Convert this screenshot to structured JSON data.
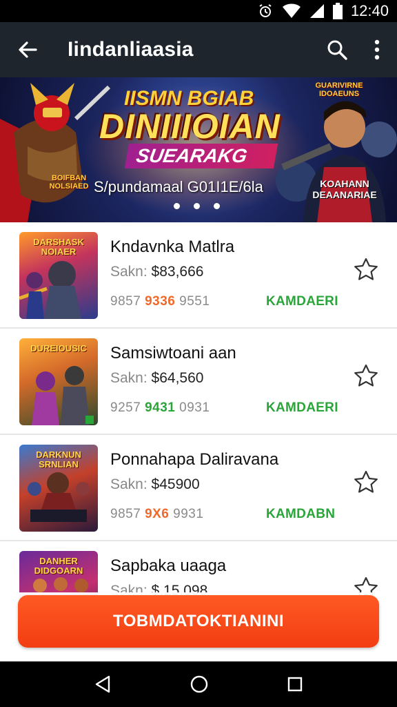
{
  "status_bar": {
    "time": "12:40"
  },
  "app_bar": {
    "title": "Iindanliaasia"
  },
  "banner": {
    "headline_top": "IISMN BGIAB",
    "headline_main": "DINIIIOIAN",
    "headline_sub": "SUEARAKG",
    "caption": "S/pundamaal G01I1E/6la",
    "badge_left": "BOIFBAN NOLSIAED",
    "badge_right": "GUARIVIRNE IDOAEUNS",
    "player_badge": "KOAHANN DEAANARIAE",
    "page_dots": 3,
    "active_dot": 1
  },
  "items": [
    {
      "name": "Kndavnka Matlra",
      "price_label": "Sakn:",
      "price": "$83,666",
      "stat_a": "9857",
      "stat_b": "9336",
      "stat_c": "9551",
      "stat_b_color": "#ef6a2a",
      "tag": "KAMDAERI",
      "thumb_label": "DARSHASK NOIAER"
    },
    {
      "name": "Samsiwtoani aan",
      "price_label": "Sakn:",
      "price": "$64,560",
      "stat_a": "9257",
      "stat_b": "9431",
      "stat_c": "0931",
      "stat_b_color": "#2aa53a",
      "tag": "KAMDAERI",
      "thumb_label": "DUREIOUSIC"
    },
    {
      "name": "Ponnahapa Daliravana",
      "price_label": "Sakn:",
      "price": "$45900",
      "stat_a": "9857",
      "stat_b": "9X6",
      "stat_c": "9931",
      "stat_b_color": "#ef6a2a",
      "tag": "KAMDABN",
      "thumb_label": "DARKNUN SRNLIAN"
    },
    {
      "name": "Sapbaka uaaga",
      "price_label": "Sakn:",
      "price": "$.15,098",
      "stat_a": "",
      "stat_b": "",
      "stat_c": "",
      "stat_b_color": "#ef6a2a",
      "tag": "",
      "thumb_label": "DANHER DIDGOARN"
    }
  ],
  "cta": {
    "label": "TOBMDATOKTIANINI"
  },
  "icons": {
    "back": "arrow-left-icon",
    "search": "search-icon",
    "more": "more-vert-icon",
    "favorite": "star-outline-icon",
    "nav_back": "triangle-back-icon",
    "nav_home": "circle-home-icon",
    "nav_recent": "square-recent-icon"
  },
  "colors": {
    "app_bar": "#1f252c",
    "accent": "#f23d12",
    "tag_green": "#2aa53a"
  }
}
